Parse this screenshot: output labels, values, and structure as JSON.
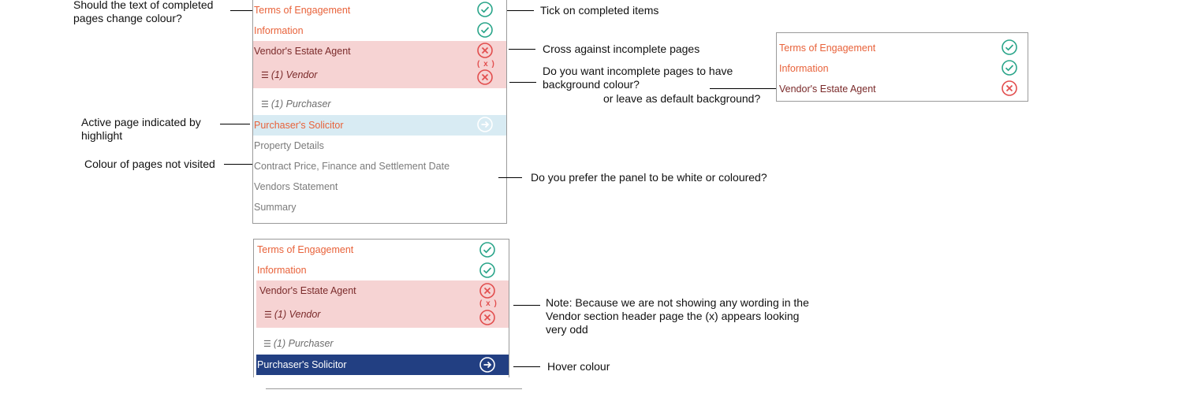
{
  "panel1": {
    "items": [
      {
        "label": "Terms of Engagement",
        "status": "done"
      },
      {
        "label": "Information",
        "status": "done"
      },
      {
        "label": "Vendor's Estate Agent",
        "status": "incomplete"
      },
      {
        "label": "(1) Vendor",
        "status": "incomplete",
        "marker": "( x )"
      },
      {
        "label": "(1) Purchaser",
        "status": "none"
      },
      {
        "label": "Purchaser's Solicitor",
        "status": "active"
      },
      {
        "label": "Property Details",
        "status": "notvisited"
      },
      {
        "label": "Contract Price, Finance and Settlement Date",
        "status": "notvisited"
      },
      {
        "label": "Vendors Statement",
        "status": "notvisited"
      },
      {
        "label": "Summary",
        "status": "notvisited"
      }
    ]
  },
  "panel2": {
    "items": [
      {
        "label": "Terms of Engagement",
        "status": "done"
      },
      {
        "label": "Information",
        "status": "done"
      },
      {
        "label": "Vendor's Estate Agent",
        "status": "incomplete"
      },
      {
        "label": "(1) Vendor",
        "status": "incomplete",
        "marker": "( x )"
      },
      {
        "label": "(1) Purchaser",
        "status": "none"
      },
      {
        "label": "Purchaser's Solicitor",
        "status": "hover"
      }
    ]
  },
  "panel3": {
    "items": [
      {
        "label": "Terms of Engagement",
        "status": "done"
      },
      {
        "label": "Information",
        "status": "done"
      },
      {
        "label": "Vendor's Estate Agent",
        "status": "incomplete"
      }
    ]
  },
  "notes": {
    "text_colour": "Should the text of completed\npages change colour?",
    "tick": "Tick on completed items",
    "cross": "Cross against incomplete pages",
    "incomplete_bg": "Do you want incomplete pages to have\nbackground colour?",
    "default_bg": "or leave as default background?",
    "active": "Active page indicated by\nhighlight",
    "not_visited": "Colour of pages not visited",
    "panel_colour": "Do you prefer the panel to be white or coloured?",
    "vendor_note": "Note: Because we are not showing any wording in the\nVendor section header page the (x) appears looking\nvery odd",
    "hover": "Hover colour"
  },
  "colors": {
    "done_text": "#e8623a",
    "incomplete_bg": "#f6d3d3",
    "active_bg": "#d8ebf3",
    "hover_bg": "#223f82",
    "tick": "#2aa58a",
    "cross": "#e24e4e"
  },
  "icons": {
    "done": "check-circle-icon",
    "incomplete": "x-circle-icon",
    "active": "arrow-right-circle-icon",
    "sub": "drag-handle-icon"
  }
}
